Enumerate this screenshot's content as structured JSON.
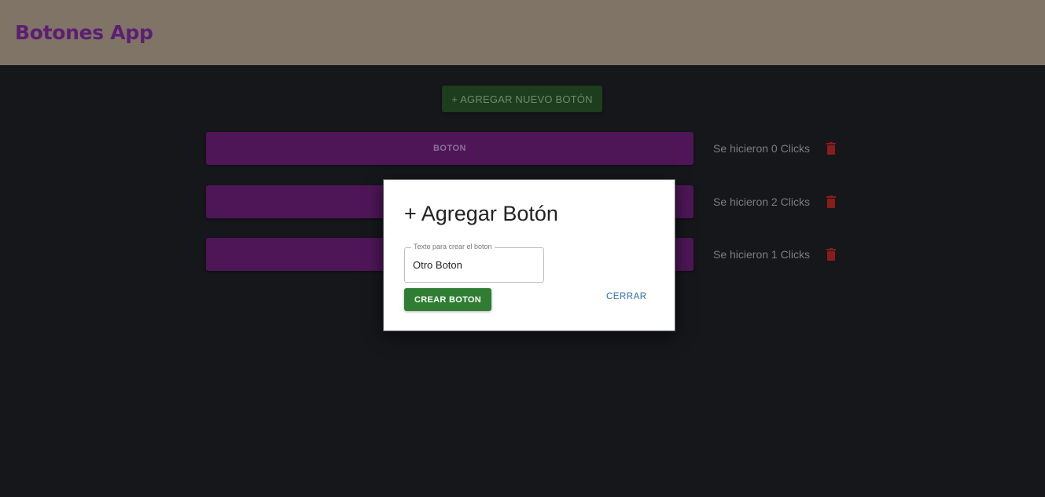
{
  "app": {
    "title": "Botones App"
  },
  "toolbar": {
    "add_new_label": "+ AGREGAR NUEVO BOTÓN"
  },
  "rows": [
    {
      "label": "BOTON",
      "count_text": "Se hicieron 0 Clicks"
    },
    {
      "label": "",
      "count_text": "Se hicieron 2 Clicks"
    },
    {
      "label": "",
      "count_text": "Se hicieron 1 Clicks"
    }
  ],
  "modal": {
    "title": "+ Agregar Botón",
    "field_label": "Texto para crear el boton",
    "field_value": "Otro Boton",
    "create_label": "CREAR BOTON",
    "close_label": "CERRAR"
  },
  "colors": {
    "header_bg": "#7f7465",
    "title_color": "#5b1e73",
    "row_button_bg": "#4e1657",
    "trash_color": "#8b1c1c",
    "create_bg": "#2e7d32",
    "close_color": "#2e6fa8"
  },
  "icons": {
    "delete": "trash-icon"
  }
}
